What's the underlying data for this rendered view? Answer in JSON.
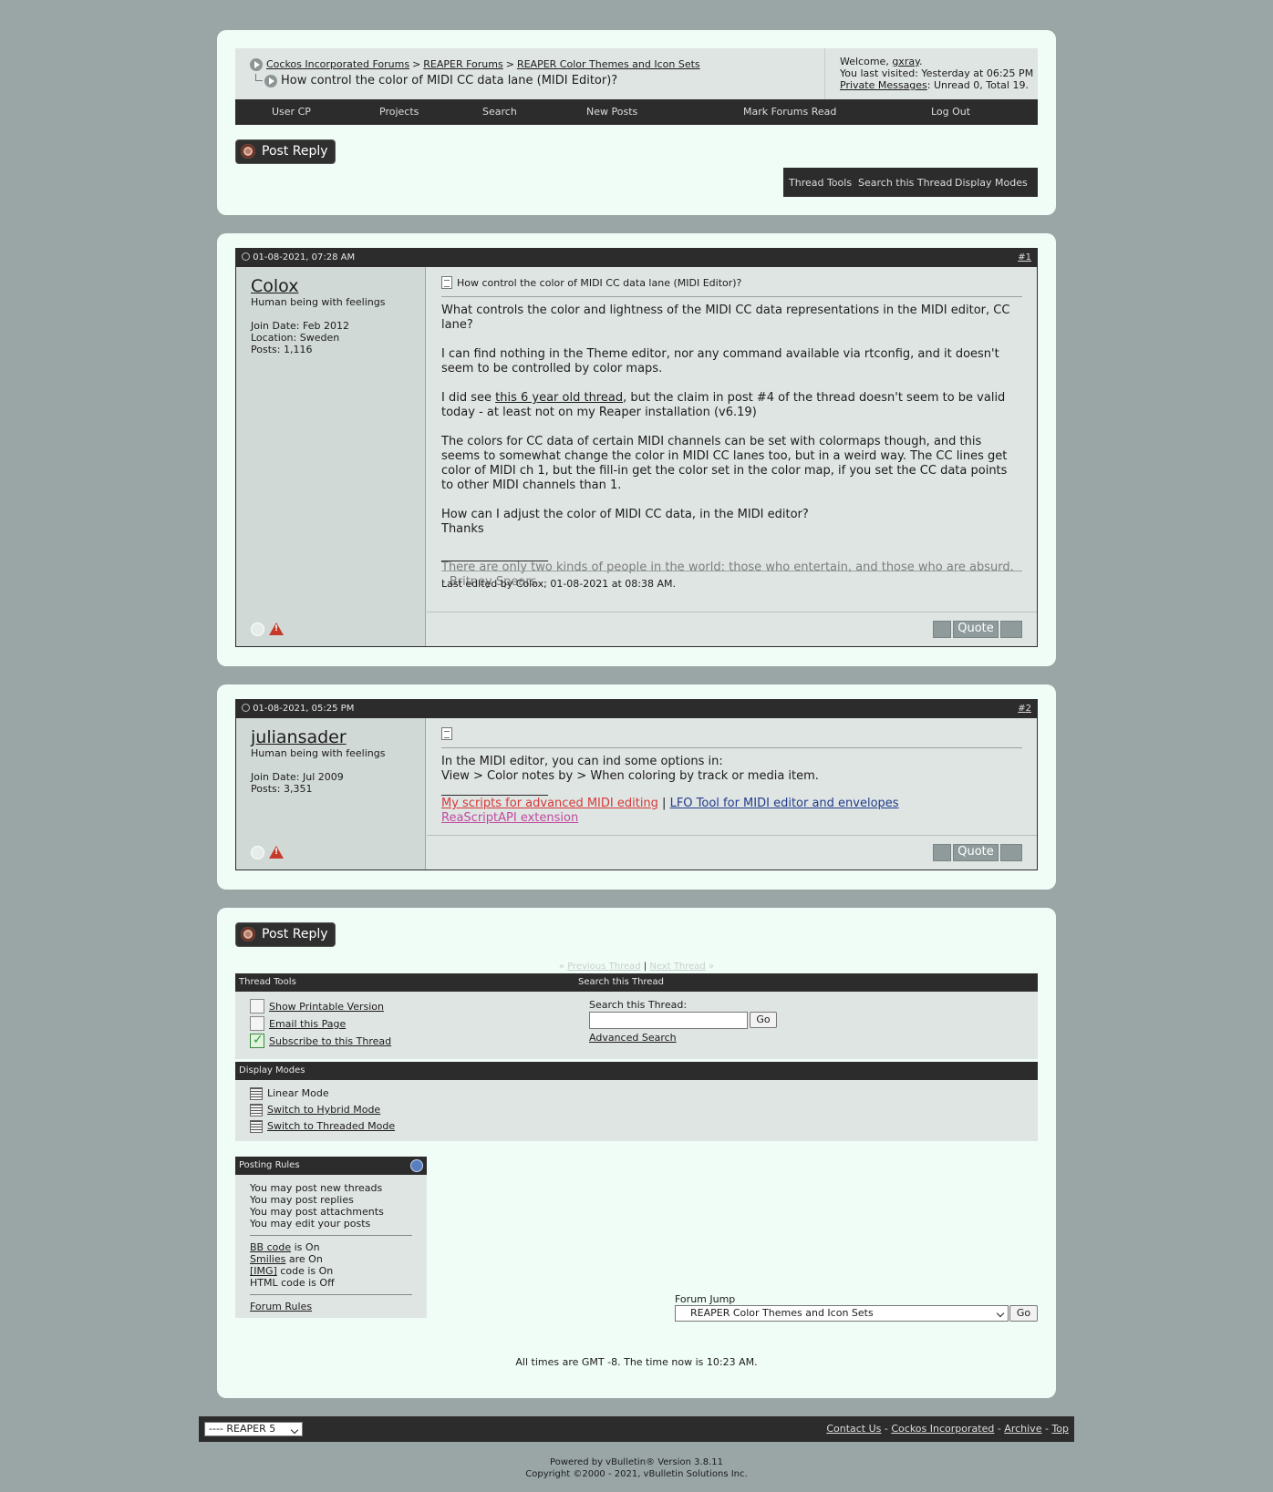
{
  "breadcrumb": {
    "items": [
      "Cockos Incorporated Forums",
      "REAPER Forums",
      "REAPER Color Themes and Icon Sets"
    ],
    "separator": ">",
    "current": "How control the color of MIDI CC data lane (MIDI Editor)?"
  },
  "welcome": {
    "prefix": "Welcome,",
    "user": "gxray",
    "suffix": ".",
    "last_visited": "You last visited: Yesterday at 06:25 PM",
    "pm_label": "Private Messages",
    "pm_status": ": Unread 0, Total 19."
  },
  "nav": [
    "User CP",
    "Projects",
    "Search",
    "New Posts",
    "Mark Forums Read",
    "Log Out"
  ],
  "post_reply_label": "Post Reply",
  "thread_tools_bar": [
    "Thread Tools",
    "Search this Thread",
    "Display Modes"
  ],
  "posts": [
    {
      "date": "01-08-2021, 07:28 AM",
      "num_prefix": "#",
      "num": "1",
      "user": "Colox",
      "usertitle": "Human being with feelings",
      "join": "Join Date: Feb 2012",
      "location": "Location: Sweden",
      "posts": "Posts: 1,116",
      "title": "How control the color of MIDI CC data lane (MIDI Editor)?",
      "p1": "What controls the color and lightness of the MIDI CC data representations in the MIDI editor, CC lane?",
      "p2": "I can find nothing in the Theme editor, nor any command available via rtconfig, and it doesn't seem to be controlled by color maps.",
      "p3a": "I did see ",
      "p3link": "this 6 year old thread",
      "p3b": ", but the claim in post #4 of the thread doesn't seem to be valid today - at least not on my Reaper installation (v6.19)",
      "p4": "The colors for CC data of certain MIDI channels can be set with colormaps though, and this seems to somewhat change the color in MIDI CC lanes too, but in a weird way. The CC lines get color of MIDI ch 1, but the fill-in get the color set in the color map, if you set the CC data points to other MIDI channels than 1.",
      "p5": "How can I adjust the color of MIDI CC data, in the MIDI editor?",
      "p6": "Thanks",
      "sigline": "__________________",
      "sig1": "There are only two kinds of people in the world: those who entertain, and those who are absurd.",
      "sig2": "- Britney Spears",
      "edited": "Last edited by Colox; 01-08-2021 at 08:38 AM.",
      "quote": "Quote"
    },
    {
      "date": "01-08-2021, 05:25 PM",
      "num_prefix": "#",
      "num": "2",
      "user": "juliansader",
      "usertitle": "Human being with feelings",
      "join": "Join Date: Jul 2009",
      "posts": "Posts: 3,351",
      "l1": "In the MIDI editor, you can ind some options in:",
      "l2": "View > Color notes by > When coloring by track or media item.",
      "sigline": "__________________",
      "sig_link1": "My scripts for advanced MIDI editing",
      "sig_sep": " | ",
      "sig_link2": "LFO Tool for MIDI editor and envelopes",
      "sig_link3": "ReaScriptAPI extension",
      "quote": "Quote"
    }
  ],
  "thread_nav": {
    "open": "«",
    "prev": "Previous Thread",
    "sep": "|",
    "next": "Next Thread",
    "close": "»"
  },
  "thread_tools": {
    "header": "Thread Tools",
    "items": [
      "Show Printable Version",
      "Email this Page",
      "Subscribe to this Thread"
    ]
  },
  "search_thread": {
    "header": "Search this Thread",
    "label": "Search this Thread:",
    "value": "",
    "go": "Go",
    "advanced": "Advanced Search"
  },
  "display_modes": {
    "header": "Display Modes",
    "items": [
      "Linear Mode",
      "Switch to Hybrid Mode",
      "Switch to Threaded Mode"
    ]
  },
  "posting_rules": {
    "header": "Posting Rules",
    "lines": [
      "You may post new threads",
      "You may post replies",
      "You may post attachments",
      "You may edit your posts"
    ],
    "bb_link": "BB code",
    "bb_rest": " is On",
    "smilies_link": "Smilies",
    "smilies_rest": " are On",
    "img_link": "[IMG]",
    "img_rest": " code is On",
    "html": "HTML code is Off",
    "forum_rules": "Forum Rules"
  },
  "forum_jump": {
    "label": "Forum Jump",
    "selected": "REAPER Color Themes and Icon Sets",
    "go": "Go"
  },
  "times": "All times are GMT -8. The time now is 10:23 AM.",
  "footer": {
    "style_select": "---- REAPER 5",
    "links": [
      "Contact Us",
      "Cockos Incorporated",
      "Archive",
      "Top"
    ],
    "link_sep": " - ",
    "powered1": "Powered by vBulletin® Version 3.8.11",
    "powered2": "Copyright ©2000 - 2021, vBulletin Solutions Inc."
  },
  "colors": {
    "background": "#9aa6a6",
    "panel": "#f0fcf6",
    "bar": "#2c2c2c",
    "post_bg": "#dfe5e3",
    "sig_red": "#d43a3a",
    "sig_blue": "#233c8c"
  }
}
